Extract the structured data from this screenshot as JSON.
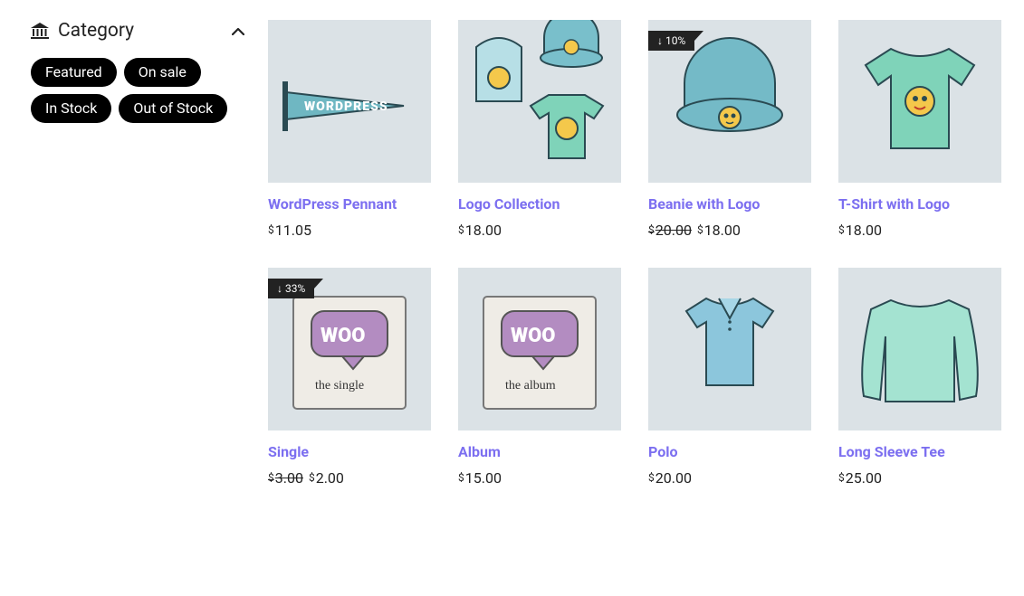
{
  "sidebar": {
    "title": "Category",
    "chips": [
      "Featured",
      "On sale",
      "In Stock",
      "Out of Stock"
    ]
  },
  "currency": "$",
  "products": [
    {
      "title": "WordPress Pennant",
      "price": "11.05",
      "old_price": null,
      "discount": null,
      "thumb": "pennant"
    },
    {
      "title": "Logo Collection",
      "price": "18.00",
      "old_price": null,
      "discount": null,
      "thumb": "collection"
    },
    {
      "title": "Beanie with Logo",
      "price": "18.00",
      "old_price": "20.00",
      "discount": "10%",
      "thumb": "beanie"
    },
    {
      "title": "T-Shirt with Logo",
      "price": "18.00",
      "old_price": null,
      "discount": null,
      "thumb": "tshirt"
    },
    {
      "title": "Single",
      "price": "2.00",
      "old_price": "3.00",
      "discount": "33%",
      "thumb": "single"
    },
    {
      "title": "Album",
      "price": "15.00",
      "old_price": null,
      "discount": null,
      "thumb": "album"
    },
    {
      "title": "Polo",
      "price": "20.00",
      "old_price": null,
      "discount": null,
      "thumb": "polo"
    },
    {
      "title": "Long Sleeve Tee",
      "price": "25.00",
      "old_price": null,
      "discount": null,
      "thumb": "longsleeve"
    }
  ]
}
